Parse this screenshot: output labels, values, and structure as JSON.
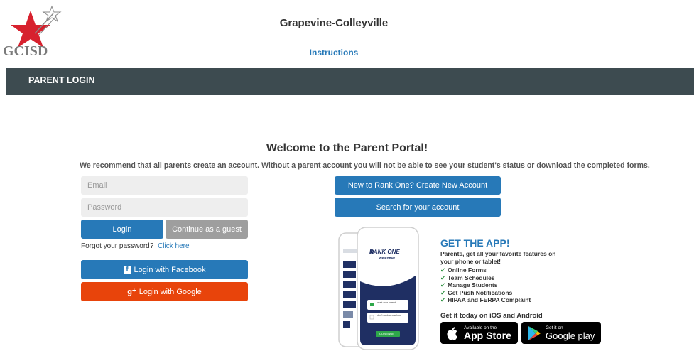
{
  "header": {
    "logo_text": "GCISD",
    "district_name": "Grapevine-Colleyville",
    "instructions_link": "Instructions"
  },
  "navbar": {
    "title": "PARENT LOGIN"
  },
  "main": {
    "welcome_title": "Welcome to the Parent Portal!",
    "recommend_text": "We recommend that all parents create an account. Without a parent account you will not be able to see your student's status or download the completed forms."
  },
  "login": {
    "email_placeholder": "Email",
    "password_placeholder": "Password",
    "login_label": "Login",
    "guest_label": "Continue as a guest",
    "forgot_text": "Forgot your password?",
    "forgot_link": "Click here",
    "facebook_label": "Login with Facebook",
    "google_label": "Login with Google"
  },
  "account": {
    "create_label": "New to Rank One? Create New Account",
    "search_label": "Search for your account"
  },
  "phone": {
    "brand": "RANK ONE",
    "welcome": "Welcome!",
    "option_parent": "I work as a parent",
    "option_school": "I don't work at a school",
    "continue": "CONTINUE"
  },
  "app_promo": {
    "title": "GET THE APP!",
    "subtitle": "Parents, get all your favorite features on your phone or tablet!",
    "features": [
      "Online Forms",
      "Team Schedules",
      "Manage Students",
      "Get Push Notifications",
      "HIPAA and FERPA Complaint"
    ],
    "get_today": "Get it today on iOS and Android",
    "appstore_small": "Available on the",
    "appstore_big": "App Store",
    "googleplay_small": "Get it on",
    "googleplay_big": "Google play"
  },
  "colors": {
    "accent": "#2779b8",
    "navbar": "#3d4b50",
    "google": "#e8440b",
    "logo_star": "#d7212e"
  }
}
